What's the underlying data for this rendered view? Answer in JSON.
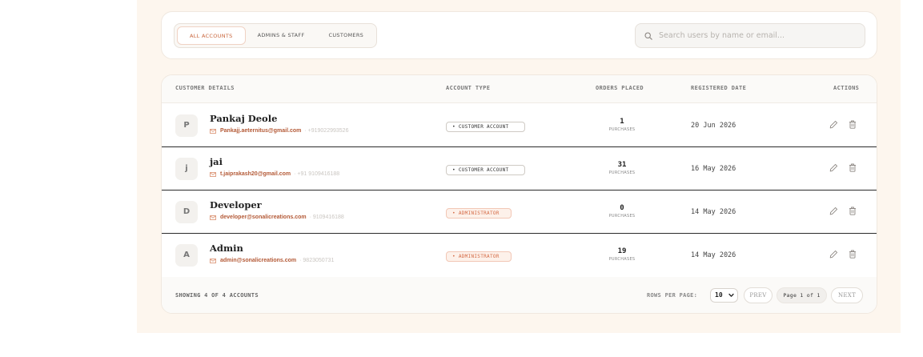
{
  "filters": {
    "tabs": [
      "ALL ACCOUNTS",
      "ADMINS & STAFF",
      "CUSTOMERS"
    ],
    "active_tab": "ALL ACCOUNTS",
    "search_placeholder": "Search users by name or email...",
    "search_value": ""
  },
  "table": {
    "columns": {
      "customer": "CUSTOMER DETAILS",
      "account_type": "ACCOUNT TYPE",
      "orders": "ORDERS PLACED",
      "registered": "REGISTERED DATE",
      "actions": "ACTIONS"
    },
    "rows": [
      {
        "initial": "P",
        "name": "Pankaj Deole",
        "email": "Pankajj.aeternitus@gmail.com",
        "phone": "· +919022993526",
        "account_type": "• CUSTOMER ACCOUNT",
        "type_kind": "customer",
        "orders": "1",
        "orders_label": "PURCHASES",
        "date": "20 Jun 2026"
      },
      {
        "initial": "j",
        "name": "jai",
        "email": "t.jaiprakash20@gmail.com",
        "phone": "· +91 9109416188",
        "account_type": "• CUSTOMER ACCOUNT",
        "type_kind": "customer",
        "orders": "31",
        "orders_label": "PURCHASES",
        "date": "16 May 2026"
      },
      {
        "initial": "D",
        "name": "Developer",
        "email": "developer@sonalicreations.com",
        "phone": "· 9109416188",
        "account_type": "• ADMINISTRATOR",
        "type_kind": "admin",
        "orders": "0",
        "orders_label": "PURCHASES",
        "date": "14 May 2026"
      },
      {
        "initial": "A",
        "name": "Admin",
        "email": "admin@sonalicreations.com",
        "phone": "· 9823050731",
        "account_type": "• ADMINISTRATOR",
        "type_kind": "admin",
        "orders": "19",
        "orders_label": "PURCHASES",
        "date": "14 May 2026"
      }
    ]
  },
  "footer": {
    "showing": "SHOWING 4 OF 4 ACCOUNTS",
    "rows_per_page_label": "ROWS PER PAGE:",
    "rows_per_page": "10",
    "prev": "PREV",
    "page": "Page 1 of 1",
    "next": "NEXT"
  },
  "colors": {
    "accent": "#c8653b",
    "panel_bg": "#fdf6ee",
    "admin_badge": "#d46a45"
  },
  "icons": {
    "search": "search-icon",
    "mail": "mail-icon",
    "edit": "pencil-icon",
    "delete": "trash-icon",
    "dropdown": "chevron-down-icon"
  }
}
